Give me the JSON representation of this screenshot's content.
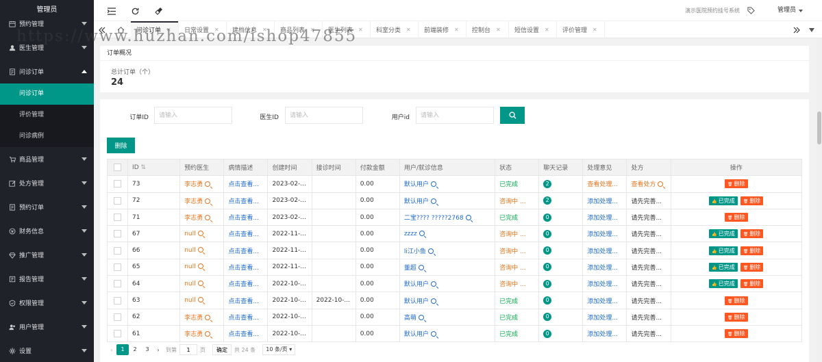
{
  "sidebar": {
    "title": "管理员",
    "items": [
      {
        "label": "预约管理",
        "icon": "calendar-icon",
        "expanded": false
      },
      {
        "label": "医生管理",
        "icon": "user-icon",
        "expanded": false
      },
      {
        "label": "问诊订单",
        "icon": "document-icon",
        "expanded": true,
        "children": [
          {
            "label": "问诊订单",
            "active": true
          },
          {
            "label": "评价管理",
            "active": false
          },
          {
            "label": "问诊病例",
            "active": false
          }
        ]
      },
      {
        "label": "商品管理",
        "icon": "cart-icon",
        "expanded": false
      },
      {
        "label": "处方管理",
        "icon": "edit-icon",
        "expanded": false
      },
      {
        "label": "预约订单",
        "icon": "document-icon",
        "expanded": false
      },
      {
        "label": "财务信息",
        "icon": "money-icon",
        "expanded": false
      },
      {
        "label": "推广管理",
        "icon": "diamond-icon",
        "expanded": false
      },
      {
        "label": "报告管理",
        "icon": "report-icon",
        "expanded": false
      },
      {
        "label": "权限管理",
        "icon": "shield-icon",
        "expanded": false
      },
      {
        "label": "用户管理",
        "icon": "users-icon",
        "expanded": false
      },
      {
        "label": "设置",
        "icon": "gear-icon",
        "expanded": false
      }
    ]
  },
  "header": {
    "site_name": "演示医院预约挂号系统",
    "user": "管理员"
  },
  "tabs": [
    {
      "label": "问诊订单",
      "active": true
    },
    {
      "label": "日常设置",
      "active": false
    },
    {
      "label": "建档信息",
      "active": false
    },
    {
      "label": "商品列表",
      "active": false
    },
    {
      "label": "医生列表",
      "active": false
    },
    {
      "label": "科室分类",
      "active": false
    },
    {
      "label": "前端装修",
      "active": false
    },
    {
      "label": "控制台",
      "active": false
    },
    {
      "label": "短信设置",
      "active": false
    },
    {
      "label": "评价管理",
      "active": false
    }
  ],
  "overview": {
    "title": "订单概况",
    "total_label": "总计订单（个）",
    "total_value": "24"
  },
  "filters": {
    "order_id_label": "订单ID",
    "doctor_id_label": "医生ID",
    "user_id_label": "用户id",
    "placeholder": "请输入"
  },
  "delete_button": "删除",
  "table": {
    "columns": [
      "ID",
      "预约医生",
      "病情描述",
      "创建时间",
      "接诊时间",
      "付款金额",
      "用户/就诊信息",
      "状态",
      "聊天记录",
      "处理意见",
      "处方",
      "操作"
    ],
    "rows": [
      {
        "id": "73",
        "doctor": "李志勇",
        "desc": "点击查看...",
        "created": "2023-02-...",
        "accepted": "",
        "amount": "0.00",
        "user": "默认用户",
        "status": "已完成",
        "chat": "2",
        "opinion": "查看处理...",
        "rx": "查看处方",
        "actions": [
          "删除"
        ]
      },
      {
        "id": "72",
        "doctor": "李志勇",
        "desc": "点击查看...",
        "created": "2023-02-...",
        "accepted": "",
        "amount": "0.00",
        "user": "默认用户",
        "status": "咨询中 ...",
        "chat": "2",
        "opinion": "添加处理...",
        "rx": "请先完善...",
        "actions": [
          "已完成",
          "删除"
        ]
      },
      {
        "id": "71",
        "doctor": "李志勇",
        "desc": "点击查看...",
        "created": "2023-02-...",
        "accepted": "",
        "amount": "0.00",
        "user": "二宝???? ?????2768",
        "status": "已完成",
        "chat": "0",
        "opinion": "添加处理...",
        "rx": "请先完善...",
        "actions": [
          "删除"
        ]
      },
      {
        "id": "67",
        "doctor": "null",
        "desc": "点击查看...",
        "created": "2022-11-...",
        "accepted": "",
        "amount": "0.00",
        "user": "zzzz",
        "status": "咨询中 ...",
        "chat": "0",
        "opinion": "添加处理...",
        "rx": "请先完善...",
        "actions": [
          "已完成",
          "删除"
        ]
      },
      {
        "id": "66",
        "doctor": "null",
        "desc": "点击查看...",
        "created": "2022-11-...",
        "accepted": "",
        "amount": "0.00",
        "user": "li江小鱼",
        "status": "咨询中 ...",
        "chat": "0",
        "opinion": "添加处理...",
        "rx": "请先完善...",
        "actions": [
          "已完成",
          "删除"
        ]
      },
      {
        "id": "65",
        "doctor": "null",
        "desc": "点击查看...",
        "created": "2022-11-...",
        "accepted": "",
        "amount": "0.00",
        "user": "董超",
        "status": "咨询中 ...",
        "chat": "0",
        "opinion": "添加处理...",
        "rx": "请先完善...",
        "actions": [
          "已完成",
          "删除"
        ]
      },
      {
        "id": "64",
        "doctor": "null",
        "desc": "点击查看...",
        "created": "2022-10-...",
        "accepted": "",
        "amount": "0.00",
        "user": "默认用户",
        "status": "咨询中 ...",
        "chat": "0",
        "opinion": "添加处理...",
        "rx": "请先完善...",
        "actions": [
          "已完成",
          "删除"
        ]
      },
      {
        "id": "63",
        "doctor": "null",
        "desc": "点击查看...",
        "created": "2022-10-...",
        "accepted": "2022-10-...",
        "amount": "0.00",
        "user": "默认用户",
        "status": "已完成",
        "chat": "0",
        "opinion": "添加处理...",
        "rx": "请先完善...",
        "actions": [
          "删除"
        ]
      },
      {
        "id": "62",
        "doctor": "李志勇",
        "desc": "点击查看...",
        "created": "2022-10-...",
        "accepted": "",
        "amount": "0.00",
        "user": "高萌",
        "status": "已完成",
        "chat": "0",
        "opinion": "添加处理...",
        "rx": "请先完善...",
        "actions": [
          "删除"
        ]
      },
      {
        "id": "61",
        "doctor": "李志勇",
        "desc": "点击查看...",
        "created": "2022-10-...",
        "accepted": "",
        "amount": "0.00",
        "user": "默认用户",
        "status": "已完成",
        "chat": "0",
        "opinion": "添加处理...",
        "rx": "请先完善...",
        "actions": [
          "删除"
        ]
      }
    ]
  },
  "pagination": {
    "pages": [
      "1",
      "2",
      "3"
    ],
    "current": "1",
    "goto_label": "到第",
    "goto_value": "1",
    "page_unit": "页",
    "confirm": "确定",
    "total": "共 24 条",
    "page_size": "10 条/页"
  },
  "watermark": "https://www.huzhan.com/ishop47855",
  "colors": {
    "accent": "#009688",
    "danger": "#ff5722",
    "sidebar": "#20222a",
    "link": "#1e6ac9",
    "warn": "#e8731a",
    "ok": "#0aa84f"
  }
}
